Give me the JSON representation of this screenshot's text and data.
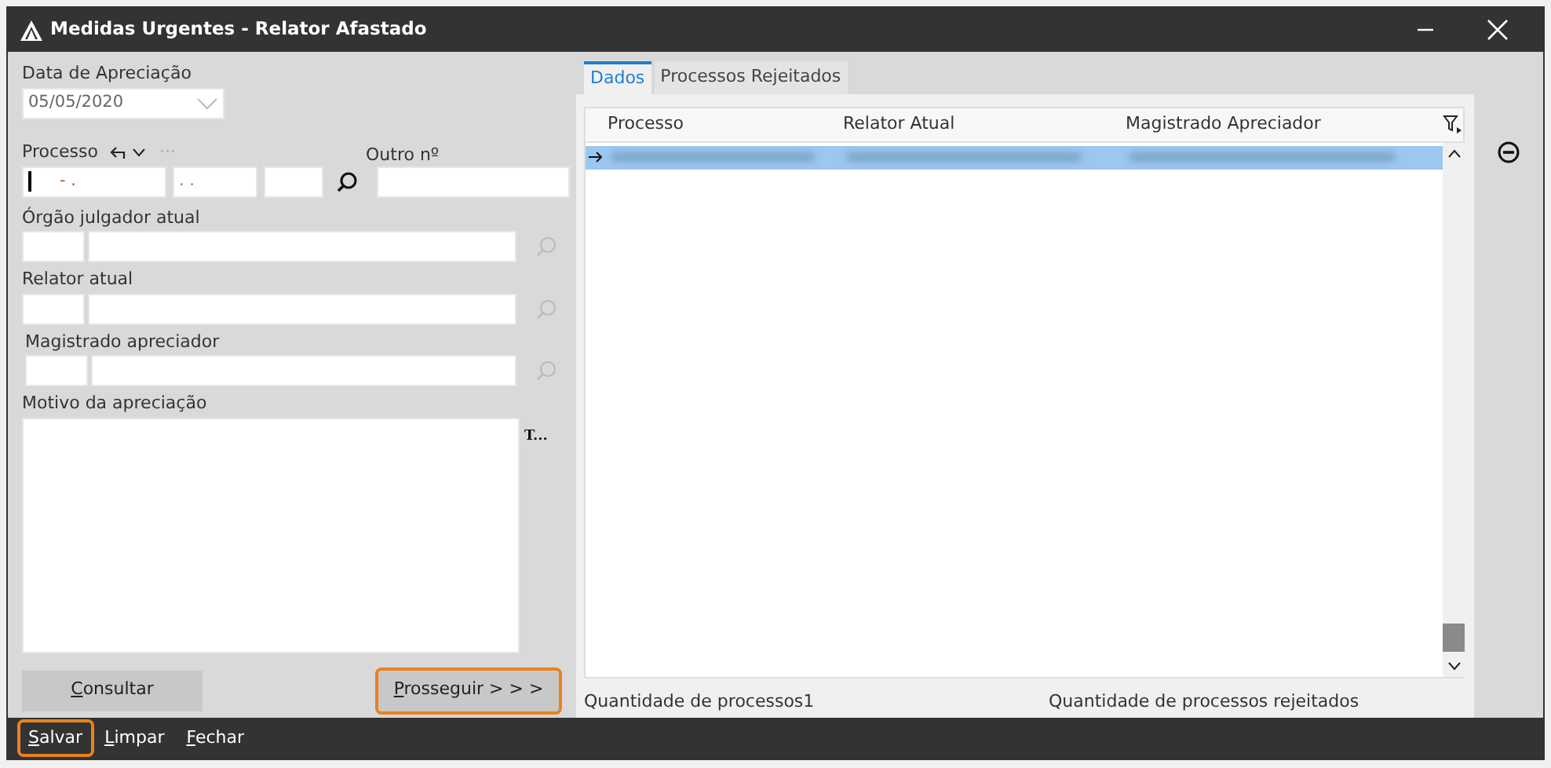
{
  "window": {
    "title": "Medidas Urgentes - Relator Afastado"
  },
  "form": {
    "date_label": "Data de Apreciação",
    "date_value": "05/05/2020",
    "processo_label": "Processo",
    "processo_more": "···",
    "processo_parts": [
      {
        "value": "- ."
      },
      {
        "value": ". ."
      }
    ],
    "outro_label": "Outro nº",
    "lookups": [
      {
        "label": "Órgão julgador atual",
        "enabled": false
      },
      {
        "label": "Relator atual",
        "enabled": false
      },
      {
        "label": "Magistrado apreciador",
        "enabled": false
      }
    ],
    "motivo_label": "Motivo da apreciação",
    "motivo_format": "T..."
  },
  "left_buttons": [
    {
      "label": "Consultar",
      "highlighted": false
    },
    {
      "label": "Prosseguir > > >",
      "highlighted": true
    }
  ],
  "tabs": [
    {
      "label": "Dados",
      "selected": true
    },
    {
      "label": "Processos Rejeitados",
      "selected": false
    }
  ],
  "table": {
    "columns": [
      "Processo",
      "Relator Atual",
      "Magistrado Apreciador"
    ],
    "rows": [
      {
        "selected": true,
        "current": true
      }
    ]
  },
  "footer": {
    "count_label": "Quantidade de processos",
    "count_value": "1",
    "rejected_label": "Quantidade de processos rejeitados"
  },
  "bottom_buttons": [
    {
      "label": "Salvar",
      "highlighted": true
    },
    {
      "label": "Limpar",
      "highlighted": false
    },
    {
      "label": "Fechar",
      "highlighted": false
    }
  ]
}
